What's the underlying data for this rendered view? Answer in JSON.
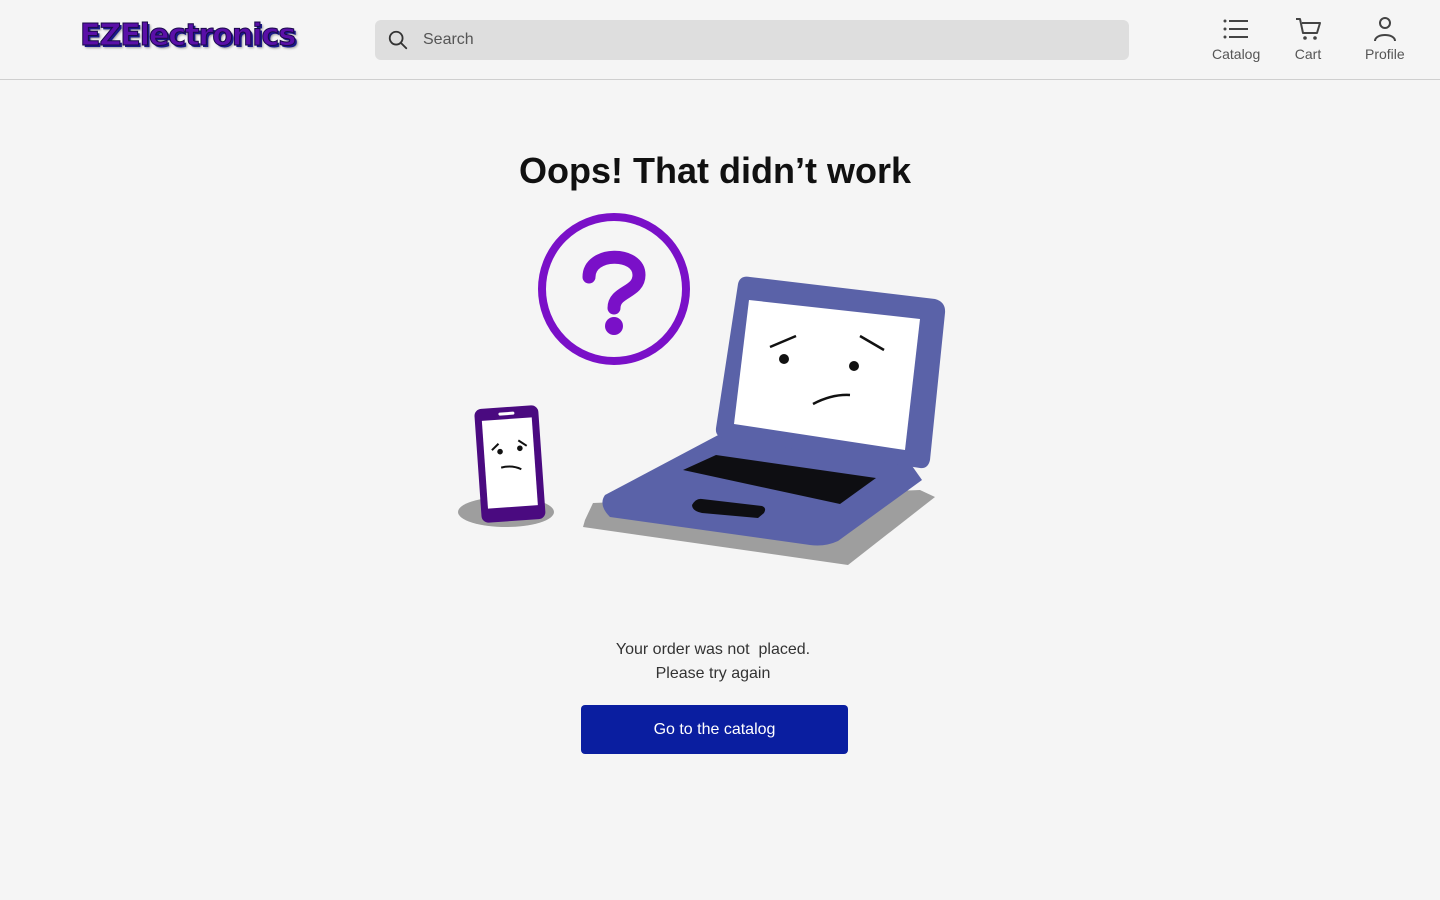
{
  "header": {
    "logo_text": "EZElectronics",
    "search": {
      "placeholder": "Search",
      "value": ""
    },
    "nav": [
      {
        "label": "Catalog",
        "icon": "list-icon"
      },
      {
        "label": "Cart",
        "icon": "cart-icon"
      },
      {
        "label": "Profile",
        "icon": "user-icon"
      }
    ]
  },
  "main": {
    "title": "Oops! That didn’t work",
    "message_line1": "Your order was not  placed.",
    "message_line2": "Please try again",
    "cta_label": "Go to the catalog",
    "illustration": "sad-devices-illustration"
  },
  "colors": {
    "accent": "#0a1ea0",
    "purple": "#7a10c8",
    "laptop": "#5a62a8",
    "background": "#f5f5f5"
  }
}
